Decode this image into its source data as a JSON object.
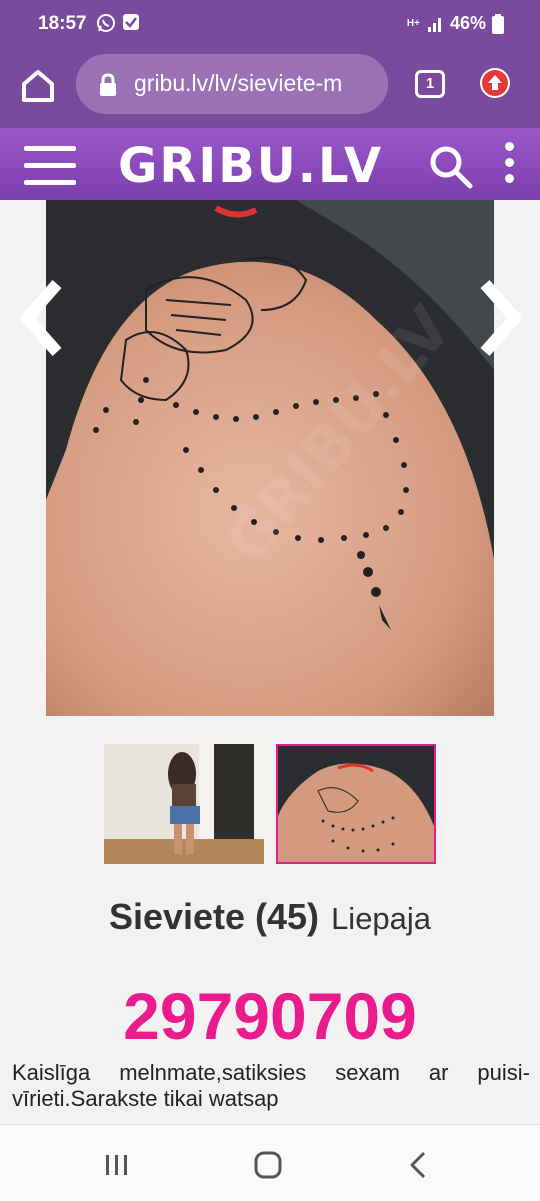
{
  "status_bar": {
    "time": "18:57",
    "battery": "46%",
    "network": "H+"
  },
  "browser": {
    "url": "gribu.lv/lv/sieviete-m",
    "tab_count": "1"
  },
  "site": {
    "logo": "GRIBU.LV",
    "watermark": "GRIBU.LV"
  },
  "profile": {
    "title": "Sieviete (45)",
    "city": "Liepaja",
    "phone": "29790709",
    "description": "Kaislīga melnmate,satiksies sexam ar puisi-vīrieti.Sarakste tikai watsap"
  },
  "gallery": {
    "selected_index": 2,
    "total_photos": 2
  },
  "colors": {
    "browser_bar": "#7a4a9e",
    "header": "#8a47bd",
    "phone": "#ea1b8c",
    "thumb_selected_border": "#e01e8c"
  }
}
